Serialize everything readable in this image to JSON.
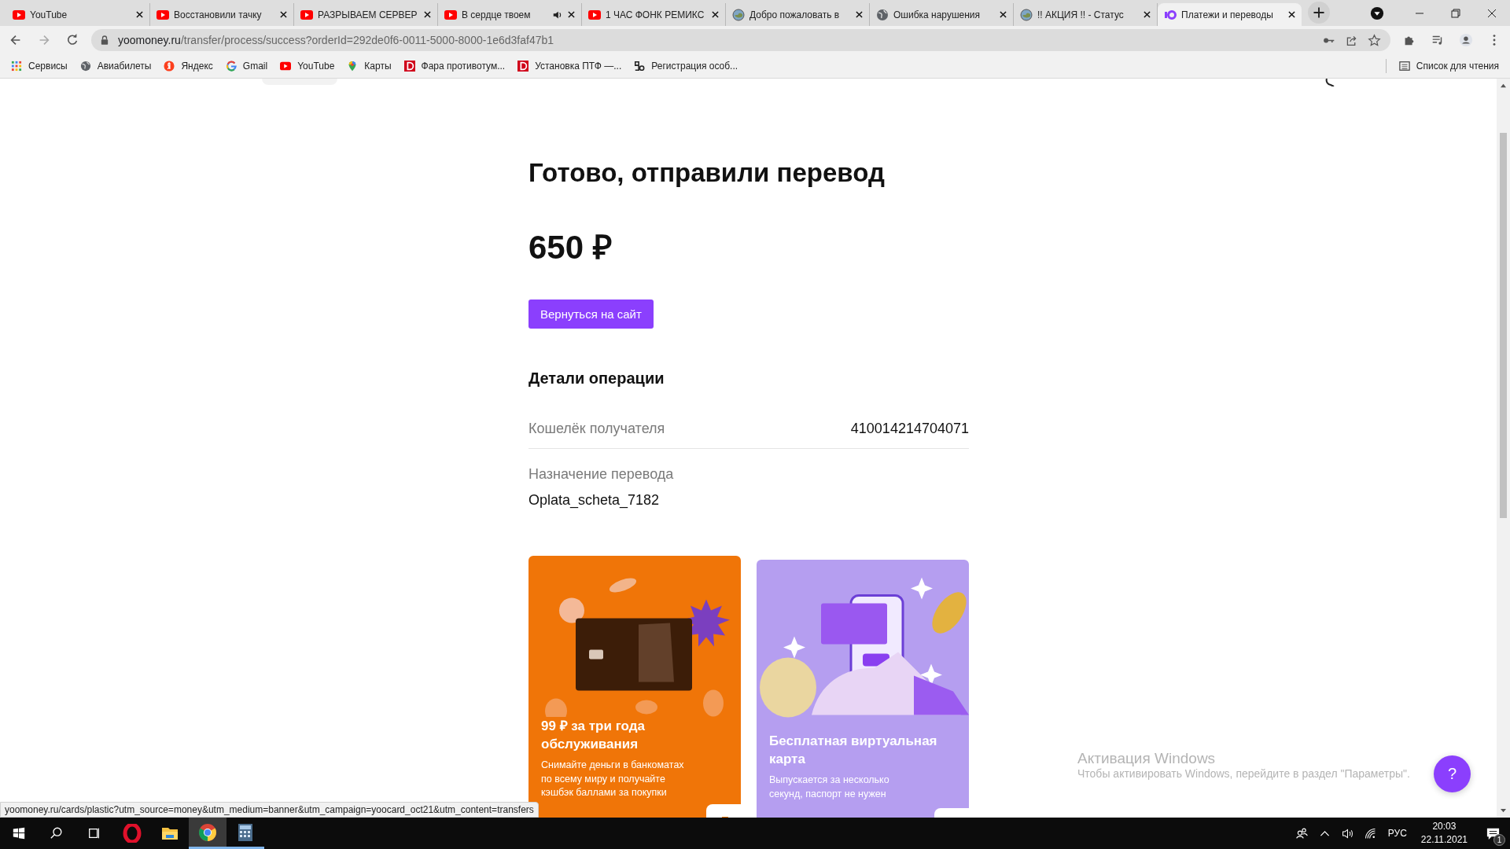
{
  "tabs": [
    {
      "title": "YouTube",
      "kind": "youtube",
      "audio": false,
      "selected": false
    },
    {
      "title": "Восстановили тачку",
      "kind": "youtube",
      "audio": false,
      "selected": false
    },
    {
      "title": "РАЗРЫВАЕМ СЕРВЕР",
      "kind": "youtube",
      "audio": false,
      "selected": false
    },
    {
      "title": "В сердце твоем",
      "kind": "youtube",
      "audio": true,
      "selected": false
    },
    {
      "title": "1 ЧАС ФОНК РЕМИКС",
      "kind": "youtube",
      "audio": false,
      "selected": false
    },
    {
      "title": "Добро пожаловать в",
      "kind": "planet",
      "audio": false,
      "selected": false
    },
    {
      "title": "Ошибка нарушения",
      "kind": "globe",
      "audio": false,
      "selected": false
    },
    {
      "title": "!! АКЦИЯ !! - Статус",
      "kind": "planet",
      "audio": false,
      "selected": false
    },
    {
      "title": "Платежи и переводы",
      "kind": "yoomoney",
      "audio": false,
      "selected": true
    }
  ],
  "address": {
    "host": "yoomoney.ru",
    "path": "/transfer/process/success?orderId=292de0f6-0011-5000-8000-1e6d3faf47b1"
  },
  "bookmarks": [
    {
      "label": "Сервисы",
      "kind": "apps"
    },
    {
      "label": "Авиабилеты",
      "kind": "globe"
    },
    {
      "label": "Яндекс",
      "kind": "yandex"
    },
    {
      "label": "Gmail",
      "kind": "google"
    },
    {
      "label": "YouTube",
      "kind": "youtube"
    },
    {
      "label": "Карты",
      "kind": "maps"
    },
    {
      "label": "Фара противотум...",
      "kind": "drom"
    },
    {
      "label": "Установка ПТФ —...",
      "kind": "drom"
    },
    {
      "label": "Регистрация особ...",
      "kind": "bo"
    }
  ],
  "reading_list": "Список для чтения",
  "page": {
    "heading": "Готово, отправили перевод",
    "amount": "650 ₽",
    "back_button": "Вернуться на сайт",
    "details_title": "Детали операции",
    "details": [
      {
        "label": "Кошелёк получателя",
        "value": "410014214704071",
        "kind": "inline"
      },
      {
        "label": "Назначение перевода",
        "value": "Oplata_scheta_7182",
        "kind": "stacked"
      }
    ],
    "promos": [
      {
        "kind": "plastic",
        "title": "99 ₽ за три года обслуживания",
        "text": "Снимайте деньги в банкоматах по всему миру и получайте кэшбэк баллами за покупки"
      },
      {
        "kind": "virtual",
        "title": "Бесплатная виртуальная карта",
        "text": "Выпускается за несколько секунд, паспорт не нужен"
      }
    ]
  },
  "status_url": "yoomoney.ru/cards/plastic?utm_source=money&utm_medium=banner&utm_campaign=yoocard_oct21&utm_content=transfers",
  "activation": {
    "title": "Активация Windows",
    "text": "Чтобы активировать Windows, перейдите в раздел \"Параметры\"."
  },
  "help_button": "?",
  "taskbar": {
    "apps": [
      {
        "kind": "opera",
        "selected": false,
        "running": false
      },
      {
        "kind": "folder",
        "selected": false,
        "running": false
      },
      {
        "kind": "chrome",
        "selected": true,
        "running": true
      },
      {
        "kind": "calculator",
        "selected": false,
        "running": true
      }
    ],
    "language": "РУС",
    "time": "20:03",
    "date": "22.11.2021",
    "notifications": "1"
  }
}
